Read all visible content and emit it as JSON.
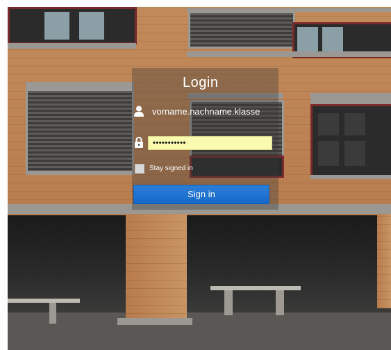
{
  "login": {
    "title": "Login",
    "username_value": "vorname.nachname.klasse",
    "password_masked": "•••••••••••",
    "stay_signed_in_label": "Stay signed in",
    "stay_signed_in_checked": false,
    "sign_in_label": "Sign in"
  },
  "icons": {
    "username": "user-icon",
    "password": "lock-icon"
  },
  "colors": {
    "password_field": "#fbfbb0",
    "sign_in_button": "#1a6fd0",
    "brick": "#b27548"
  }
}
